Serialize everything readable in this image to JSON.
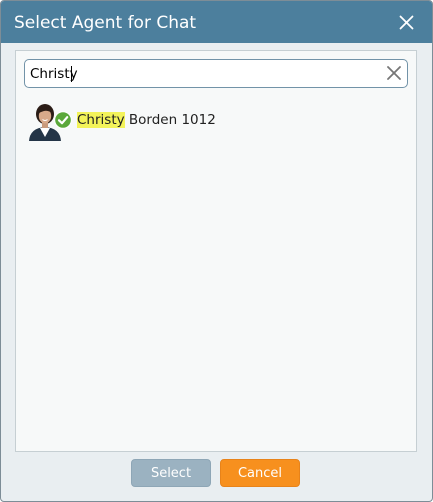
{
  "dialog": {
    "title": "Select Agent for Chat",
    "close_icon": "close-icon"
  },
  "search": {
    "value": "Christy",
    "clear_icon": "clear-x-icon"
  },
  "agents": [
    {
      "highlight": "Christy",
      "rest": "Borden 1012",
      "status": "available",
      "status_icon": "check-circle-icon",
      "status_color": "#5aa83a"
    }
  ],
  "buttons": {
    "select_label": "Select",
    "cancel_label": "Cancel"
  },
  "colors": {
    "titlebar": "#4c7f9d",
    "select_button": "#9bb2c1",
    "cancel_button": "#f7901e",
    "highlight": "#f3f35a"
  }
}
